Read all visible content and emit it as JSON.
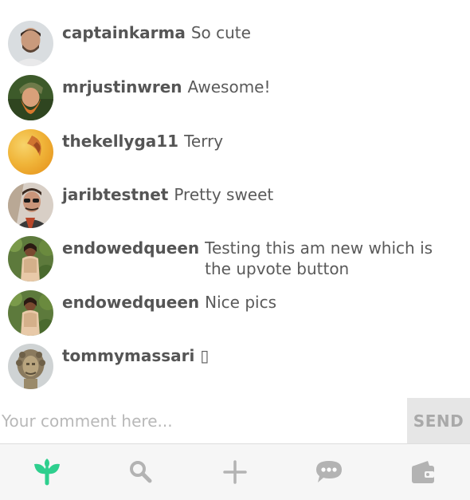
{
  "comments": [
    {
      "username": "captainkarma",
      "text": "So cute",
      "avatar": "avatar-captainkarma"
    },
    {
      "username": "mrjustinwren",
      "text": "Awesome!",
      "avatar": "avatar-mrjustinwren"
    },
    {
      "username": "thekellyga11",
      "text": "Terry",
      "avatar": "avatar-thekellyga11"
    },
    {
      "username": "jaribtestnet",
      "text": "Pretty sweet",
      "avatar": "avatar-jaribtestnet"
    },
    {
      "username": "endowedqueen",
      "text": "Testing this am new which is the upvote button",
      "avatar": "avatar-endowedqueen"
    },
    {
      "username": "endowedqueen",
      "text": "Nice pics",
      "avatar": "avatar-endowedqueen"
    },
    {
      "username": "tommymassari",
      "text": "▯",
      "avatar": "avatar-tommymassari"
    }
  ],
  "comment_bar": {
    "placeholder": "Your comment here...",
    "send_label": "SEND"
  },
  "nav": {
    "items": [
      {
        "icon": "sprout-icon",
        "active": true
      },
      {
        "icon": "search-icon",
        "active": false
      },
      {
        "icon": "plus-icon",
        "active": false
      },
      {
        "icon": "chat-bubble-icon",
        "active": false
      },
      {
        "icon": "wallet-icon",
        "active": false
      }
    ]
  },
  "colors": {
    "accent": "#2ecf8e",
    "nav_icon": "#b3b3b3",
    "send_bg": "#e6e6e6",
    "username": "#555555"
  }
}
